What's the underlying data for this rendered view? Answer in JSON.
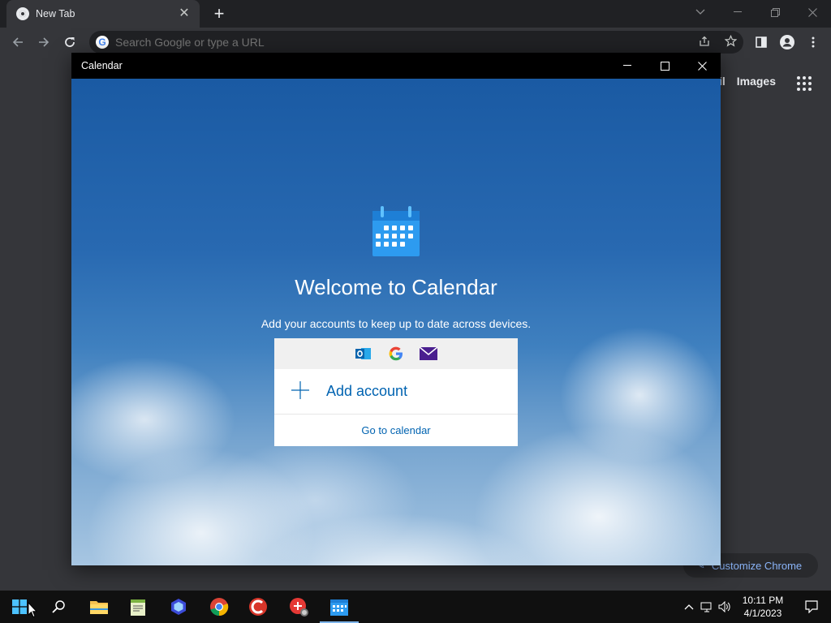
{
  "browser": {
    "tab_title": "New Tab",
    "tab_close": "✕",
    "new_tab": "+",
    "omnibox_placeholder": "Search Google or type a URL",
    "ntp_links": [
      "ail",
      "Images"
    ],
    "customize_label": "Customize Chrome"
  },
  "calendar_window": {
    "title": "Calendar",
    "welcome_title": "Welcome to Calendar",
    "subtitle": "Add your accounts to keep up to date across devices.",
    "providers": [
      "outlook-icon",
      "google-icon",
      "mail-icon"
    ],
    "add_account_label": "Add account",
    "go_to_calendar_label": "Go to calendar"
  },
  "taskbar": {
    "apps": [
      "start-button",
      "search-button",
      "file-explorer",
      "notepad-app",
      "app-icon",
      "chrome-app",
      "ccleaner-app",
      "security-app",
      "calendar-app"
    ],
    "time": "10:11 PM",
    "date": "4/1/2023"
  },
  "colors": {
    "chrome_bg": "#35363a",
    "tabstrip_bg": "#202124",
    "accent_blue": "#0063b1",
    "taskbar_bg": "#101010"
  }
}
